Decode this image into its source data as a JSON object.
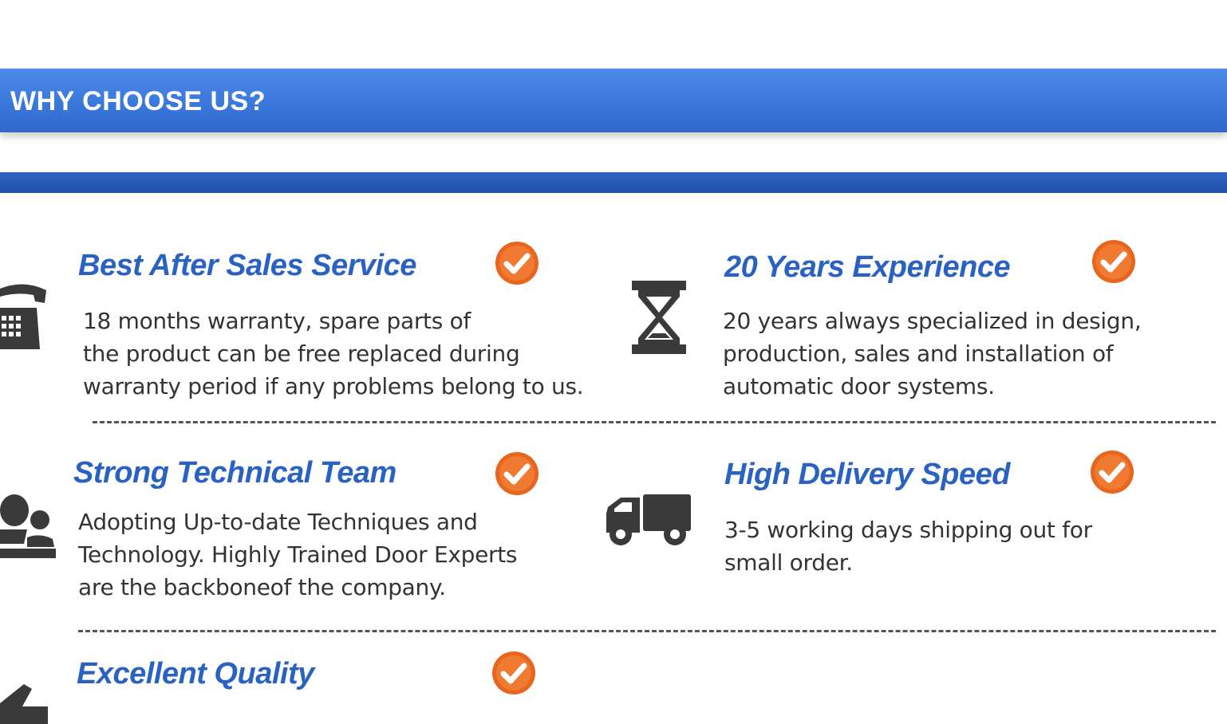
{
  "header": {
    "title": "WHY CHOOSE US?"
  },
  "colors": {
    "header_blue": "#3a78dc",
    "accent_blue": "#2a5bb8",
    "title_blue": "#2a62c4",
    "check_orange": "#e8651e",
    "text": "#333333",
    "icon": "#3a3a3a"
  },
  "features": [
    {
      "title": "Best After Sales Service",
      "description": "18 months warranty, spare parts of\nthe product can be free replaced during\nwarranty period if any problems belong to us.",
      "icon": "telephone-icon"
    },
    {
      "title": "20 Years Experience",
      "description": "20 years always specialized in design,\nproduction, sales and installation of\nautomatic door systems.",
      "icon": "hourglass-icon"
    },
    {
      "title": "Strong Technical Team",
      "description": "Adopting Up-to-date Techniques and\nTechnology. Highly Trained Door Experts\nare the backboneof the company.",
      "icon": "team-icon"
    },
    {
      "title": "High Delivery Speed",
      "description": "3-5 working days shipping out for\nsmall order.",
      "icon": "truck-icon"
    },
    {
      "title": "Excellent Quality",
      "description": "",
      "icon": "thumbs-up-icon"
    }
  ]
}
